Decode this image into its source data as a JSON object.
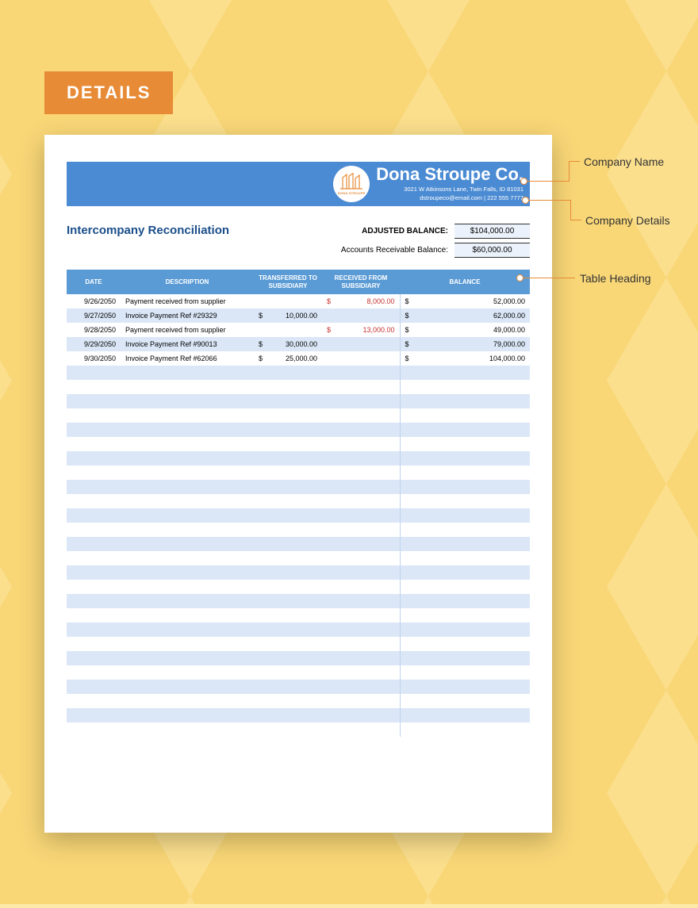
{
  "tag": "DETAILS",
  "company": {
    "name": "Dona Stroupe Co.",
    "logo_label": "DONA STROUPE",
    "address": "3021 W Atkinsons Lane, Twin Falls, ID 81031",
    "contact": "dstroupeco@email.com | 222 555 7777"
  },
  "doc_title": "Intercompany Reconciliation",
  "balances": {
    "adjusted_label": "ADJUSTED BALANCE:",
    "adjusted_value": "$104,000.00",
    "ar_label": "Accounts Receivable Balance:",
    "ar_value": "$60,000.00"
  },
  "headers": {
    "date": "DATE",
    "description": "DESCRIPTION",
    "transferred": "TRANSFERRED TO SUBSIDIARY",
    "received": "RECEIVED FROM SUBSIDIARY",
    "balance": "BALANCE"
  },
  "rows": [
    {
      "date": "9/26/2050",
      "desc": "Payment received from supplier",
      "transferred": "",
      "received": "8,000.00",
      "balance": "52,000.00"
    },
    {
      "date": "9/27/2050",
      "desc": "Invoice Payment Ref #29329",
      "transferred": "10,000.00",
      "received": "",
      "balance": "62,000.00"
    },
    {
      "date": "9/28/2050",
      "desc": "Payment received from supplier",
      "transferred": "",
      "received": "13,000.00",
      "balance": "49,000.00"
    },
    {
      "date": "9/29/2050",
      "desc": "Invoice Payment Ref #90013",
      "transferred": "30,000.00",
      "received": "",
      "balance": "79,000.00"
    },
    {
      "date": "9/30/2050",
      "desc": "Invoice Payment Ref #62066",
      "transferred": "25,000.00",
      "received": "",
      "balance": "104,000.00"
    }
  ],
  "empty_rows": 26,
  "callouts": {
    "company_name": "Company Name",
    "company_details": "Company Details",
    "table_heading": "Table Heading"
  }
}
